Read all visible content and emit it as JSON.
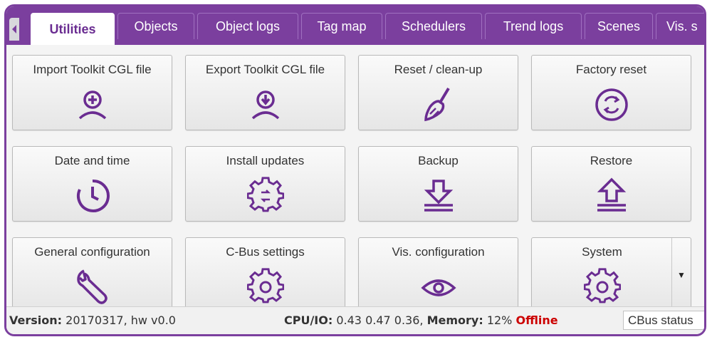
{
  "tabs": [
    {
      "label": "Utilities",
      "active": true
    },
    {
      "label": "Objects"
    },
    {
      "label": "Object logs"
    },
    {
      "label": "Tag map"
    },
    {
      "label": "Schedulers"
    },
    {
      "label": "Trend logs"
    },
    {
      "label": "Scenes"
    },
    {
      "label": "Vis. s"
    }
  ],
  "tiles": [
    {
      "label": "Import Toolkit CGL file",
      "icon": "import-icon"
    },
    {
      "label": "Export Toolkit CGL file",
      "icon": "export-icon"
    },
    {
      "label": "Reset / clean-up",
      "icon": "broom-icon"
    },
    {
      "label": "Factory reset",
      "icon": "factory-reset-icon"
    },
    {
      "label": "Date and time",
      "icon": "clock-icon"
    },
    {
      "label": "Install updates",
      "icon": "update-gear-icon"
    },
    {
      "label": "Backup",
      "icon": "backup-icon"
    },
    {
      "label": "Restore",
      "icon": "restore-icon"
    },
    {
      "label": "General configuration",
      "icon": "wrench-icon"
    },
    {
      "label": "C-Bus settings",
      "icon": "gear-icon"
    },
    {
      "label": "Vis. configuration",
      "icon": "eye-icon"
    },
    {
      "label": "System",
      "icon": "gear-icon"
    }
  ],
  "status": {
    "version_label": "Version:",
    "version_value": " 20170317, hw v0.0",
    "cpu_label": "CPU/IO:",
    "cpu_value": " 0.43 0.47 0.36, ",
    "memory_label": "Memory:",
    "memory_value": " 12% ",
    "connection": "Offline",
    "cbus_status": "CBus status"
  },
  "colors": {
    "accent": "#7b3f9e",
    "offline": "#cc0000"
  }
}
